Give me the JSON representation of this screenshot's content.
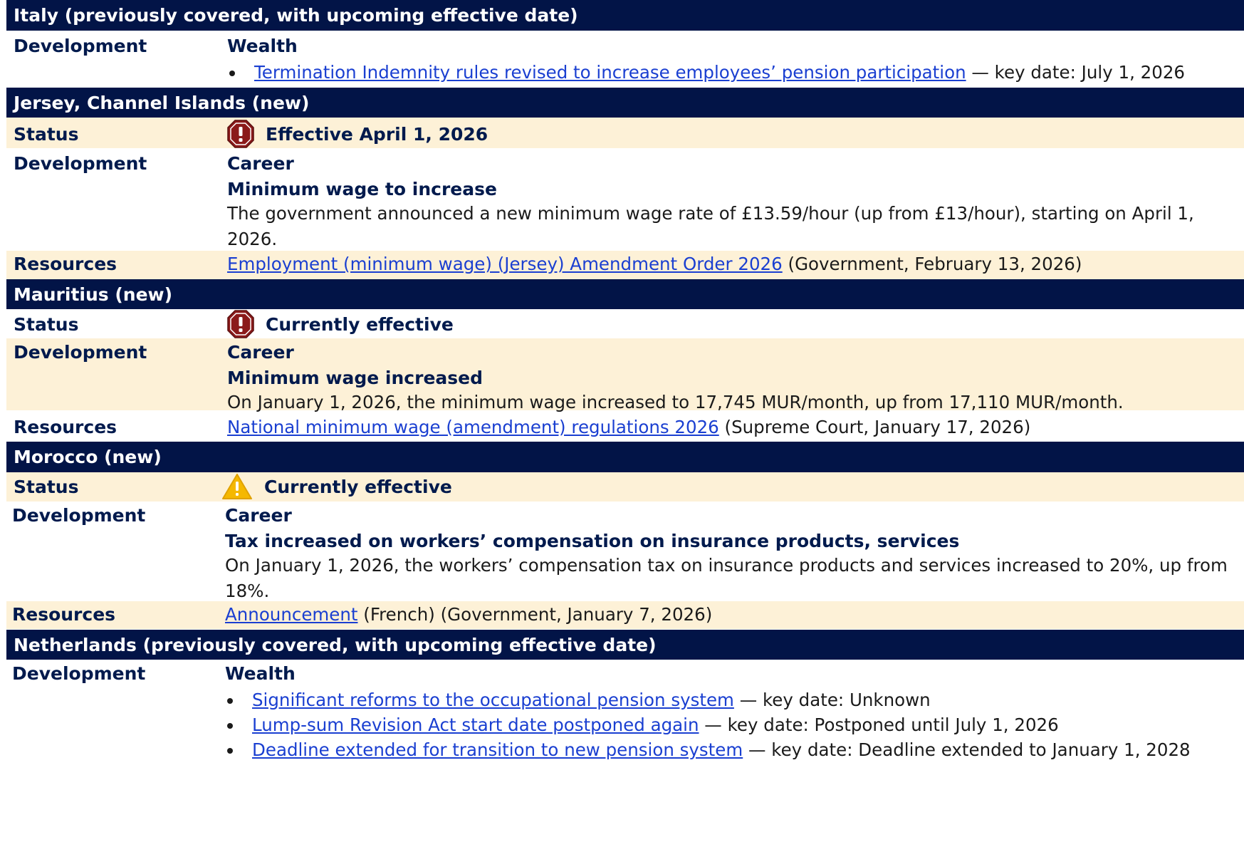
{
  "sections": {
    "italy": {
      "header": "Italy (previously covered, with upcoming effective date)",
      "development_label": "Development",
      "category": "Wealth",
      "bullets": [
        {
          "link": "Termination Indemnity rules revised to increase employees’ pension participation",
          "suffix": " — key date: July 1, 2026"
        }
      ]
    },
    "jersey": {
      "header": "Jersey, Channel Islands (new)",
      "status_label": "Status",
      "status_icon": "stop-alert-icon",
      "status_text": "Effective April 1, 2026",
      "development_label": "Development",
      "category": "Career",
      "title": "Minimum wage to increase",
      "body": "The government announced a new minimum wage rate of £13.59/hour (up from £13/hour), starting on April 1, 2026.",
      "resources_label": "Resources",
      "resource_link": "Employment (minimum wage) (Jersey) Amendment Order 2026",
      "resource_suffix": " (Government, February 13, 2026)"
    },
    "mauritius": {
      "header": "Mauritius (new)",
      "status_label": "Status",
      "status_icon": "stop-alert-icon",
      "status_text": "Currently effective",
      "development_label": "Development",
      "category": "Career",
      "title": "Minimum wage increased",
      "body": "On January 1, 2026, the minimum wage increased to 17,745 MUR/month, up from 17,110 MUR/month.",
      "resources_label": "Resources",
      "resource_link": "National minimum wage (amendment) regulations 2026",
      "resource_suffix": " (Supreme Court, January 17, 2026)"
    },
    "morocco": {
      "header": "Morocco (new)",
      "status_label": "Status",
      "status_icon": "warning-icon",
      "status_text": "Currently effective",
      "development_label": "Development",
      "category": "Career",
      "title": "Tax increased on workers’ compensation on insurance products, services",
      "body": "On January 1, 2026, the workers’ compensation tax on insurance products and services increased to 20%, up from 18%.",
      "resources_label": "Resources",
      "resource_link": "Announcement",
      "resource_suffix": " (French) (Government, January 7, 2026)"
    },
    "netherlands": {
      "header": "Netherlands (previously covered, with upcoming effective date)",
      "development_label": "Development",
      "category": "Wealth",
      "bullets": [
        {
          "link": "Significant reforms to the occupational pension system",
          "suffix": " — key date: Unknown"
        },
        {
          "link": "Lump-sum Revision Act start date postponed again",
          "suffix": " — key date: Postponed until July 1, 2026"
        },
        {
          "link": "Deadline extended for transition to new pension system",
          "suffix": " — key date: Deadline extended to January 1, 2028"
        }
      ]
    }
  },
  "colors": {
    "header_bg": "#021447",
    "band_bg": "#fdf1d7",
    "label_text": "#001a4d",
    "link": "#1a3fd1",
    "stop_icon": "#8b1a1a",
    "warning_icon": "#f5b800"
  }
}
